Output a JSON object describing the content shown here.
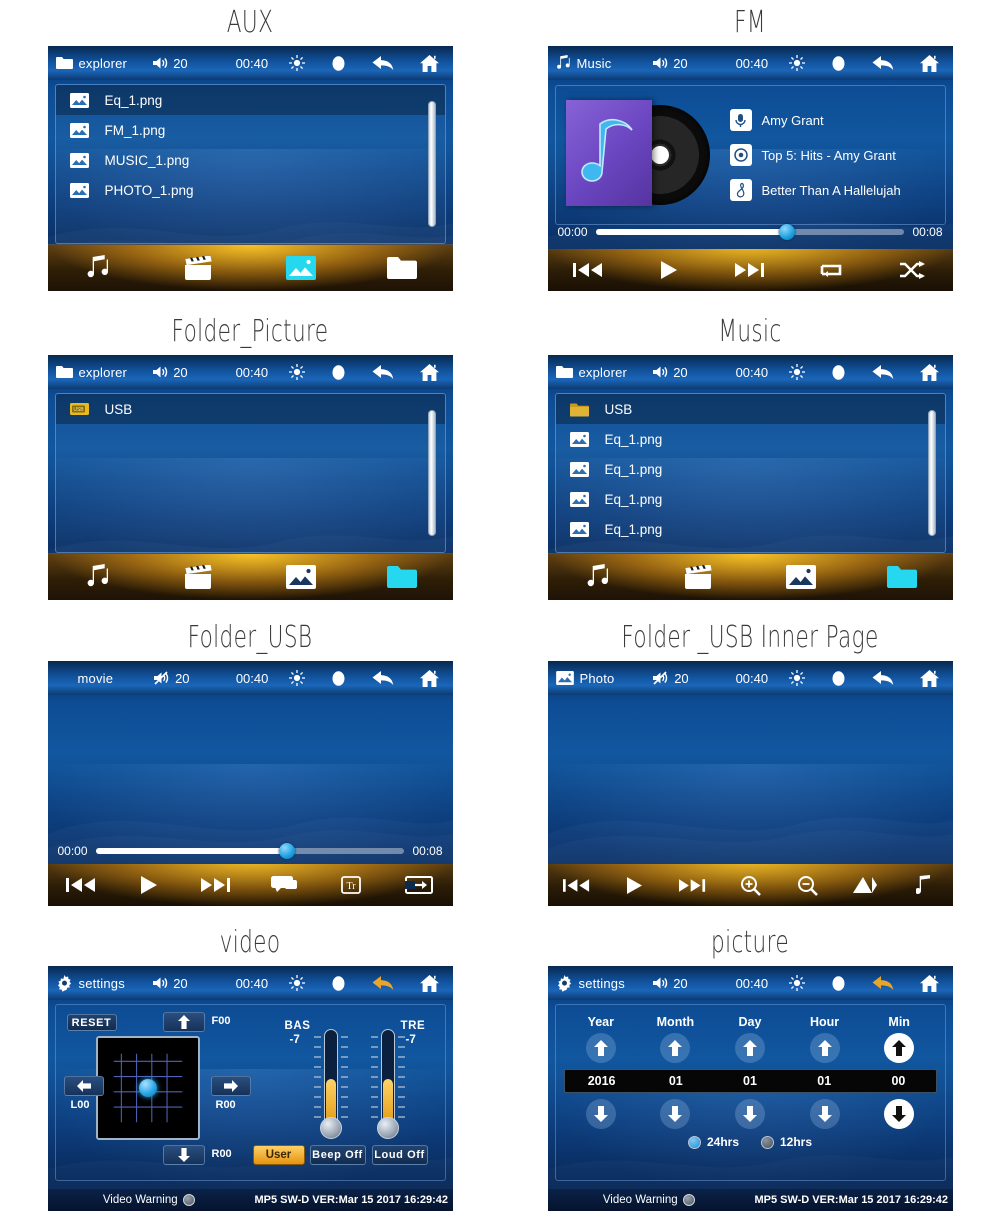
{
  "page": {
    "title": "Car MP5 Head Unit UI Screens"
  },
  "common": {
    "volume": "20",
    "clock": "00:40",
    "icons": {
      "brightness": "sun-icon",
      "mute_dot": "record-dot-icon",
      "back": "back-arrow-icon",
      "home": "home-icon",
      "speaker": "speaker-icon",
      "speaker_muted": "speaker-muted-icon"
    }
  },
  "panels": [
    {
      "caption": "AUX",
      "type": "filelist",
      "header": {
        "title": "explorer",
        "icon": "folder-icon"
      },
      "rows": [
        {
          "label": "Eq_1.png",
          "icon": "image-icon",
          "selected": true
        },
        {
          "label": "FM_1.png",
          "icon": "image-icon",
          "selected": false
        },
        {
          "label": "MUSIC_1.png",
          "icon": "image-icon",
          "selected": false
        },
        {
          "label": "PHOTO_1.png",
          "icon": "image-icon",
          "selected": false
        }
      ],
      "nav": [
        {
          "name": "music-tab",
          "icon": "music-note-icon",
          "active": false
        },
        {
          "name": "movie-tab",
          "icon": "clapperboard-icon",
          "active": false
        },
        {
          "name": "photo-tab",
          "icon": "image-icon",
          "active": true
        },
        {
          "name": "folder-tab",
          "icon": "folder-icon",
          "active": false
        }
      ]
    },
    {
      "caption": "FM",
      "type": "music",
      "header": {
        "title": "Music",
        "icon": "music-note-icon"
      },
      "info": [
        {
          "icon": "microphone-icon",
          "text": "Amy Grant"
        },
        {
          "icon": "disc-icon",
          "text": "Top 5: Hits - Amy Grant"
        },
        {
          "icon": "treble-clef-icon",
          "text": "Better Than A Hallelujah"
        }
      ],
      "progress": {
        "elapsed": "00:00",
        "total": "00:08",
        "percent": 62
      },
      "controls": [
        {
          "name": "previous-button",
          "icon": "previous-track-icon"
        },
        {
          "name": "play-button",
          "icon": "play-icon"
        },
        {
          "name": "next-button",
          "icon": "next-track-icon"
        },
        {
          "name": "repeat-button",
          "icon": "repeat-icon"
        },
        {
          "name": "shuffle-button",
          "icon": "shuffle-icon"
        }
      ]
    },
    {
      "caption": "Folder_Picture",
      "type": "filelist",
      "header": {
        "title": "explorer",
        "icon": "folder-icon"
      },
      "rows": [
        {
          "label": "USB",
          "icon": "usb-icon",
          "selected": true
        }
      ],
      "nav": [
        {
          "name": "music-tab",
          "icon": "music-note-icon",
          "active": false
        },
        {
          "name": "movie-tab",
          "icon": "clapperboard-icon",
          "active": false
        },
        {
          "name": "photo-tab",
          "icon": "image-icon",
          "active": false
        },
        {
          "name": "folder-tab",
          "icon": "folder-icon",
          "active": true
        }
      ]
    },
    {
      "caption": "Music",
      "type": "filelist",
      "header": {
        "title": "explorer",
        "icon": "folder-icon"
      },
      "rows": [
        {
          "label": "USB",
          "icon": "folder-gold-icon",
          "selected": true
        },
        {
          "label": "Eq_1.png",
          "icon": "image-icon",
          "selected": false
        },
        {
          "label": "Eq_1.png",
          "icon": "image-icon",
          "selected": false
        },
        {
          "label": "Eq_1.png",
          "icon": "image-icon",
          "selected": false
        },
        {
          "label": "Eq_1.png",
          "icon": "image-icon",
          "selected": false
        }
      ],
      "nav": [
        {
          "name": "music-tab",
          "icon": "music-note-icon",
          "active": false
        },
        {
          "name": "movie-tab",
          "icon": "clapperboard-icon",
          "active": false
        },
        {
          "name": "photo-tab",
          "icon": "image-icon",
          "active": false
        },
        {
          "name": "folder-tab",
          "icon": "folder-icon",
          "active": true
        }
      ]
    },
    {
      "caption": "Folder_USB",
      "type": "video",
      "header": {
        "title": "movie",
        "icon": "none"
      },
      "progress": {
        "elapsed": "00:00",
        "total": "00:08",
        "percent": 62
      },
      "controls": [
        {
          "name": "previous-button",
          "icon": "previous-track-icon"
        },
        {
          "name": "play-button",
          "icon": "play-icon"
        },
        {
          "name": "next-button",
          "icon": "next-track-icon"
        },
        {
          "name": "subtitle-button",
          "icon": "subtitle-icon"
        },
        {
          "name": "text-track-button",
          "icon": "text-track-icon"
        },
        {
          "name": "screen-output-button",
          "icon": "screen-output-icon"
        }
      ]
    },
    {
      "caption": "Folder _USB Inner Page",
      "type": "photo",
      "header": {
        "title": "Photo",
        "icon": "image-icon"
      },
      "controls": [
        {
          "name": "previous-button",
          "icon": "previous-track-icon"
        },
        {
          "name": "play-button",
          "icon": "play-icon"
        },
        {
          "name": "next-button",
          "icon": "next-track-icon"
        },
        {
          "name": "zoom-in-button",
          "icon": "zoom-in-icon"
        },
        {
          "name": "zoom-out-button",
          "icon": "zoom-out-icon"
        },
        {
          "name": "rotate-button",
          "icon": "rotate-icon"
        },
        {
          "name": "music-button",
          "icon": "music-note-icon"
        }
      ]
    },
    {
      "caption": "video",
      "type": "settings-audio",
      "header": {
        "title": "settings",
        "icon": "gear-icon"
      },
      "reset_label": "RESET",
      "fader": {
        "front": "F00",
        "rear": "R00",
        "left": "L00",
        "right": "R00"
      },
      "bass": {
        "label": "BAS",
        "value": "-7",
        "percent": 48
      },
      "treble": {
        "label": "TRE",
        "value": "-7",
        "percent": 48
      },
      "buttons": [
        {
          "name": "eq-preset-button",
          "label": "User",
          "style": "amber"
        },
        {
          "name": "beep-toggle-button",
          "label": "Beep Off",
          "style": "dark"
        },
        {
          "name": "loud-toggle-button",
          "label": "Loud Off",
          "style": "dark"
        }
      ],
      "footer": {
        "video_warning": "Video Warning",
        "version": "MP5 SW-D VER:Mar 15 2017 16:29:42"
      }
    },
    {
      "caption": "picture",
      "type": "settings-time",
      "header": {
        "title": "settings",
        "icon": "gear-icon"
      },
      "columns": [
        {
          "label": "Year",
          "value": "2016",
          "active": false
        },
        {
          "label": "Month",
          "value": "01",
          "active": false
        },
        {
          "label": "Day",
          "value": "01",
          "active": false
        },
        {
          "label": "Hour",
          "value": "01",
          "active": false
        },
        {
          "label": "Min",
          "value": "00",
          "active": true
        }
      ],
      "format": [
        {
          "label": "24hrs",
          "selected": true
        },
        {
          "label": "12hrs",
          "selected": false
        }
      ],
      "footer": {
        "video_warning": "Video Warning",
        "version": "MP5 SW-D VER:Mar 15 2017 16:29:42"
      }
    }
  ]
}
